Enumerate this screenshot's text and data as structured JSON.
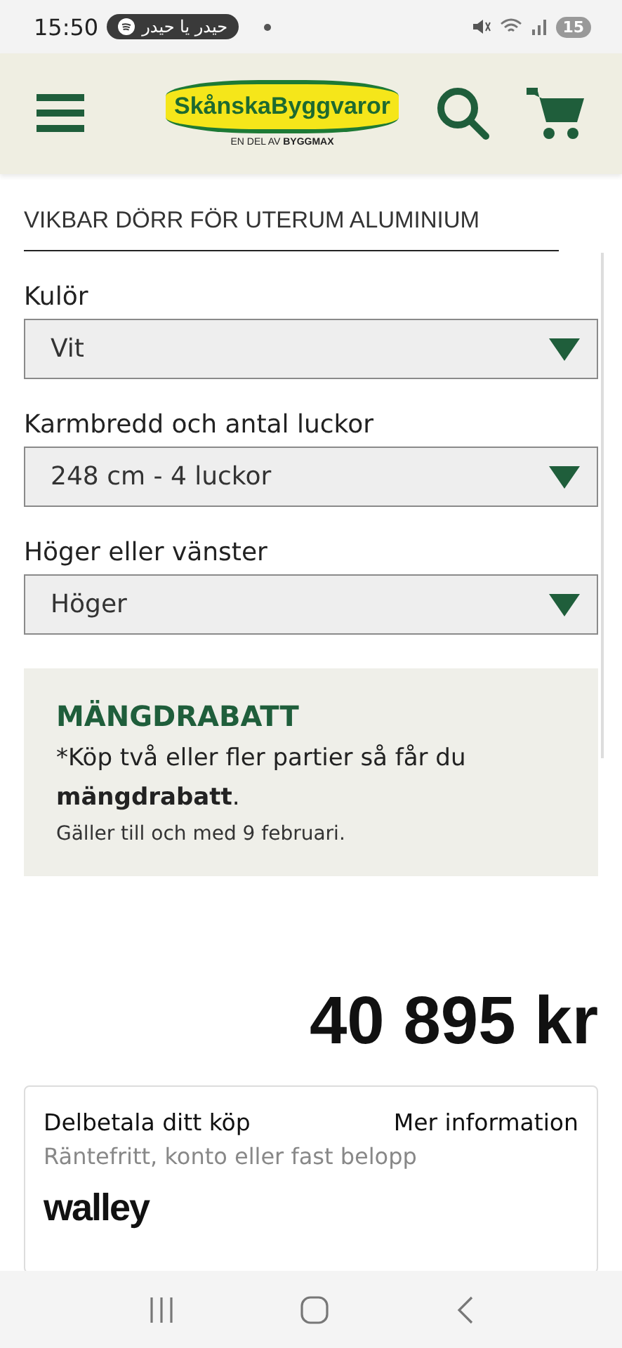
{
  "status_bar": {
    "time": "15:50",
    "media_chip": "حيدر يا حيدر",
    "battery": "15"
  },
  "header": {
    "logo_text": "SkånskaByggvaror",
    "logo_subtitle_prefix": "EN DEL AV",
    "logo_subtitle_brand": "BYGGMAX"
  },
  "product": {
    "subtitle": "VIKBAR DÖRR FÖR UTERUM ALUMINIUM"
  },
  "options": [
    {
      "label": "Kulör",
      "value": "Vit"
    },
    {
      "label": "Karmbredd och antal luckor",
      "value": "248 cm - 4 luckor"
    },
    {
      "label": "Höger eller vänster",
      "value": "Höger"
    }
  ],
  "promo": {
    "title": "MÄNGDRABATT",
    "text": "*Köp två eller fler partier så får du **mängdrabatt**.",
    "note": "Gäller till och med 9 februari."
  },
  "price": "40 895 kr",
  "financing": {
    "title": "Delbetala ditt köp",
    "link": "Mer information",
    "description": "Räntefritt, konto eller fast belopp",
    "provider": "walley"
  }
}
